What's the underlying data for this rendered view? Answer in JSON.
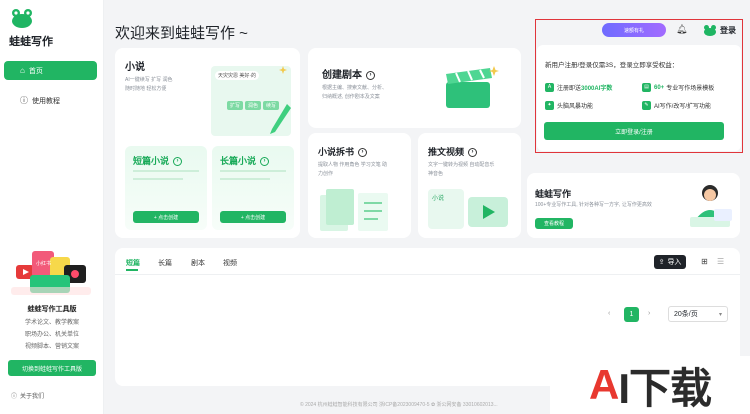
{
  "app": {
    "brand": "蛙蛙写作"
  },
  "sidebar": {
    "items": [
      {
        "label": "首页"
      },
      {
        "label": "使用教程"
      }
    ],
    "promo": {
      "title": "蛙蛙写作工具版",
      "lines": [
        "学术论文、教学教案",
        "职场办公、机关单位",
        "视频脚本、营销文案"
      ],
      "button": "切换到蛙蛙写作工具版",
      "sticker": "小红书"
    },
    "about": "关于我们"
  },
  "header": {
    "welcome": "欢迎来到蛙蛙写作 ~",
    "vip": "速额有礼",
    "login": "登录"
  },
  "cards": {
    "novel": {
      "title": "小说",
      "desc": "AI一键续写 扩写 润色\n随时随地 轻松方便",
      "short": {
        "title": "短篇小说",
        "button": "+ 点击创建"
      },
      "long": {
        "title": "长篇小说",
        "button": "+ 点击创建"
      },
      "chips": [
        "扩写",
        "润色",
        "续写"
      ],
      "bubble": "天灾灾恩 美好·的"
    },
    "script": {
      "title": "创建剧本",
      "desc": "根据主编、搜索文献、分析、\n归纳概述, 创作剧本及文案"
    },
    "split": {
      "title": "小说拆书",
      "desc": "提取人物 作用角色 学习文笔 助\n力创作"
    },
    "video": {
      "title": "推文视频",
      "desc": "文字一键转为视频 自动配音乐\n神音色",
      "label": "小说"
    },
    "promo": {
      "title": "蛙蛙写作",
      "desc": "100+专业写作工具, 针对各种写一方字, 让写作更高效",
      "button": "查看教程"
    }
  },
  "tabs": {
    "items": [
      {
        "label": "短篇"
      },
      {
        "label": "长篇"
      },
      {
        "label": "剧本"
      },
      {
        "label": "视频"
      }
    ],
    "import": "导入",
    "page": "1",
    "page_size": "20条/页"
  },
  "login_panel": {
    "headline": "新用户注册/登录仅需3S，登录立即享受权益：",
    "b1_pre": "注册即送",
    "b1_hl": "3000AI字数",
    "b2_hl": "60+",
    "b2_post": "专业写作场景模板",
    "b3": "头脑风暴功能",
    "b4": "AI写作/改写/扩写功能",
    "button": "立即登录/注册"
  },
  "footer": "© 2024 杭州蛙蛙智能科技有限公司 浙ICP备2023009470-5  ✿ 浙公网安备 33010602013...",
  "watermark": {
    "a": "A",
    "rest": "I下载"
  },
  "colors": {
    "accent": "#21b563",
    "vip": "#7a6bff",
    "highlight_frame": "#e0353b"
  }
}
